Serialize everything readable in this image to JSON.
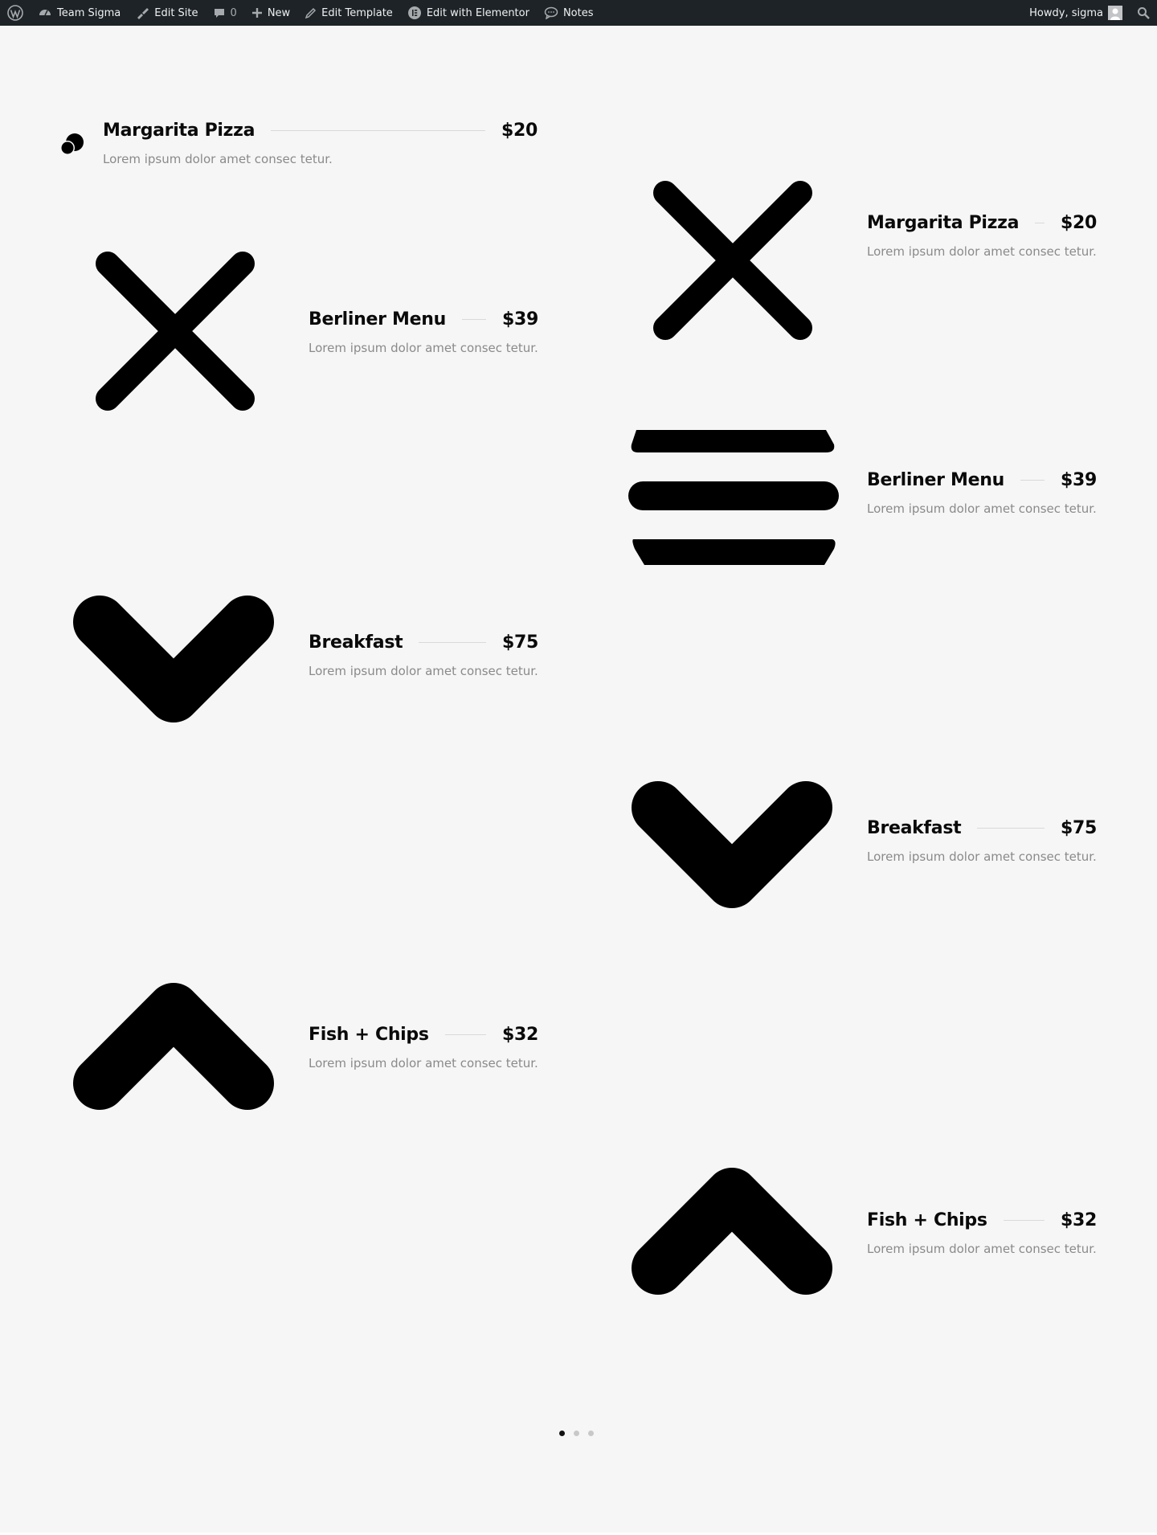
{
  "adminbar": {
    "site_name": "Team Sigma",
    "edit_site": "Edit Site",
    "comments_count": "0",
    "new": "New",
    "edit_template": "Edit Template",
    "edit_with_elementor": "Edit with Elementor",
    "notes": "Notes",
    "howdy": "Howdy, sigma"
  },
  "menu_left": [
    {
      "title": "Margarita Pizza",
      "price": "$20",
      "desc": "Lorem ipsum dolor amet consec tetur.",
      "icon": "chat-bubbles-icon"
    },
    {
      "title": "Berliner Menu",
      "price": "$39",
      "desc": "Lorem ipsum dolor amet consec tetur.",
      "icon": "close-x-icon"
    },
    {
      "title": "Breakfast",
      "price": "$75",
      "desc": "Lorem ipsum dolor amet consec tetur.",
      "icon": "chevron-down-icon"
    },
    {
      "title": "Fish + Chips",
      "price": "$32",
      "desc": "Lorem ipsum dolor amet consec tetur.",
      "icon": "chevron-up-icon"
    }
  ],
  "menu_right": [
    {
      "title": "Margarita Pizza",
      "price": "$20",
      "desc": "Lorem ipsum dolor amet consec tetur.",
      "icon": "close-x-icon"
    },
    {
      "title": "Berliner Menu",
      "price": "$39",
      "desc": "Lorem ipsum dolor amet consec tetur.",
      "icon": "hamburger-menu-icon"
    },
    {
      "title": "Breakfast",
      "price": "$75",
      "desc": "Lorem ipsum dolor amet consec tetur.",
      "icon": "chevron-down-icon"
    },
    {
      "title": "Fish + Chips",
      "price": "$32",
      "desc": "Lorem ipsum dolor amet consec tetur.",
      "icon": "chevron-up-icon"
    }
  ],
  "pagination": {
    "total": 3,
    "active": 1
  },
  "colors": {
    "adminbar": "#1d2327",
    "background": "#f6f6f6",
    "text": "#0a0a0a",
    "muted": "#8a8a8a",
    "rule": "#d9d9d9"
  }
}
